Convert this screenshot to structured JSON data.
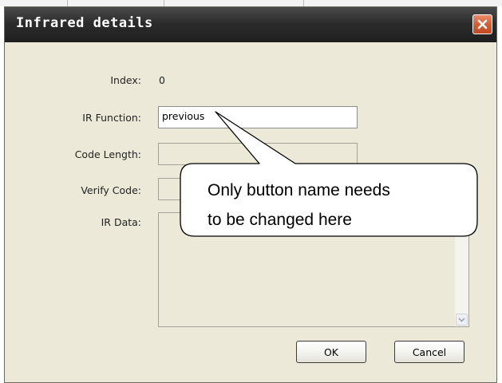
{
  "window": {
    "title": "Infrared details",
    "close_icon": "close-icon"
  },
  "form": {
    "index_label": "Index:",
    "index_value": "0",
    "ir_function_label": "IR Function:",
    "ir_function_value": "previous",
    "code_length_label": "Code Length:",
    "code_length_value": "",
    "verify_code_label": "Verify Code:",
    "verify_code_value": "",
    "ir_data_label": "IR Data:",
    "ir_data_value": ""
  },
  "buttons": {
    "ok_label": "OK",
    "cancel_label": "Cancel"
  },
  "annotation": {
    "line1": "Only button name needs",
    "line2": "to be changed here"
  },
  "colors": {
    "titlebar": "#2c2c2c",
    "dialog_bg": "#ece9d8",
    "close_button": "#d45f36"
  }
}
